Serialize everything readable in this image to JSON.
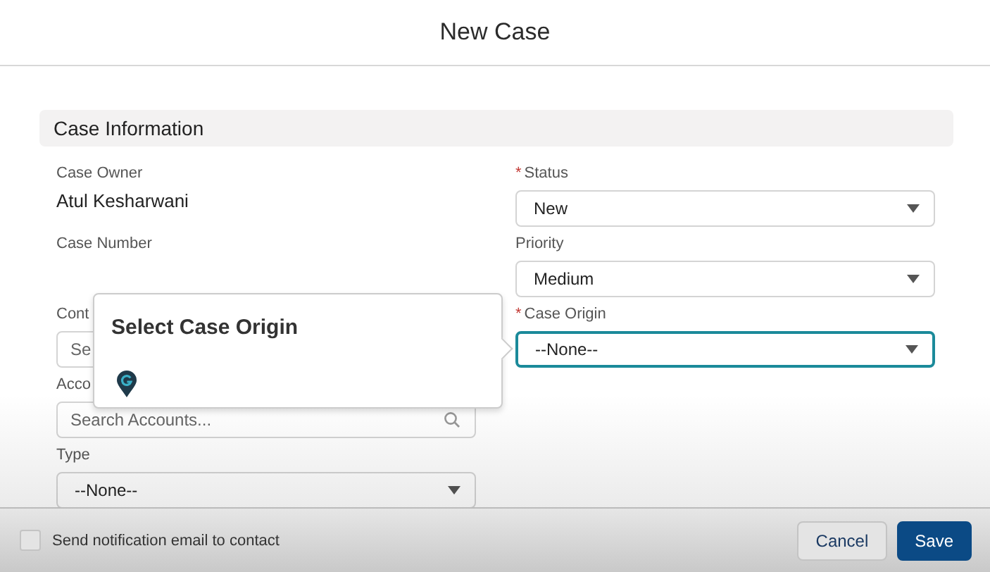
{
  "modal": {
    "title": "New Case"
  },
  "section": {
    "title": "Case Information"
  },
  "left_fields": [
    {
      "kind": "text",
      "label": "Case Owner",
      "value": "Atul Kesharwani"
    },
    {
      "kind": "text",
      "label": "Case Number"
    },
    {
      "kind": "lookup",
      "label": "Cont",
      "placeholder": "Se",
      "focused": false
    },
    {
      "kind": "lookup",
      "label": "Acco",
      "placeholder": "Search Accounts...",
      "focused": false,
      "search_icon": true
    },
    {
      "kind": "picklist",
      "label": "Type",
      "value": "--None--",
      "focused": false
    }
  ],
  "right_fields": [
    {
      "kind": "picklist",
      "required_marker": "*",
      "label": "Status",
      "value": "New",
      "focused": false
    },
    {
      "kind": "picklist",
      "label": "Priority",
      "value": "Medium",
      "focused": false
    },
    {
      "kind": "picklist",
      "required_marker": "*",
      "label": "Case Origin",
      "value": "--None--",
      "focused": true
    }
  ],
  "popover": {
    "title": "Select Case Origin"
  },
  "footer": {
    "checkbox": {
      "label": "Send notification email to contact",
      "checked": false
    },
    "buttons": [
      {
        "label": "Cancel",
        "kind": "neutral"
      },
      {
        "label": "Save",
        "kind": "brand"
      }
    ]
  }
}
